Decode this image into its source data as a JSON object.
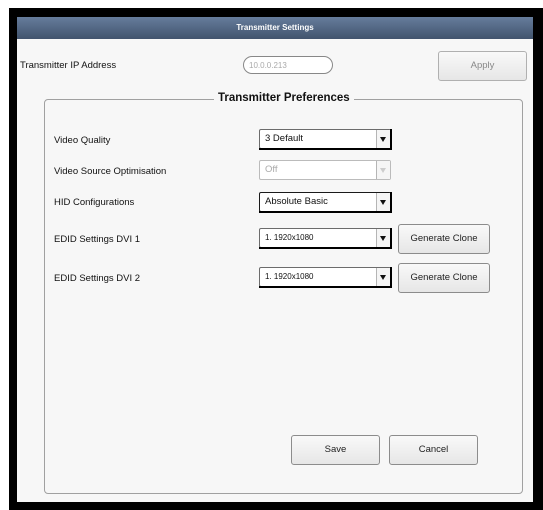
{
  "window": {
    "title": "Transmitter Settings"
  },
  "ip": {
    "label": "Transmitter IP Address",
    "value": "10.0.0.213",
    "apply_label": "Apply"
  },
  "group": {
    "title": "Transmitter Preferences"
  },
  "fields": [
    {
      "label": "Video Quality",
      "value": "3 Default"
    },
    {
      "label": "Video Source Optimisation",
      "value": "Off"
    },
    {
      "label": "HID Configurations",
      "value": "Absolute Basic"
    },
    {
      "label": "EDID Settings  DVI 1",
      "value": "1. 1920x1080",
      "button": "Generate Clone"
    },
    {
      "label": "EDID Settings  DVI 2",
      "value": "1. 1920x1080",
      "button": "Generate Clone"
    }
  ],
  "footer": {
    "save_label": "Save",
    "cancel_label": "Cancel"
  }
}
